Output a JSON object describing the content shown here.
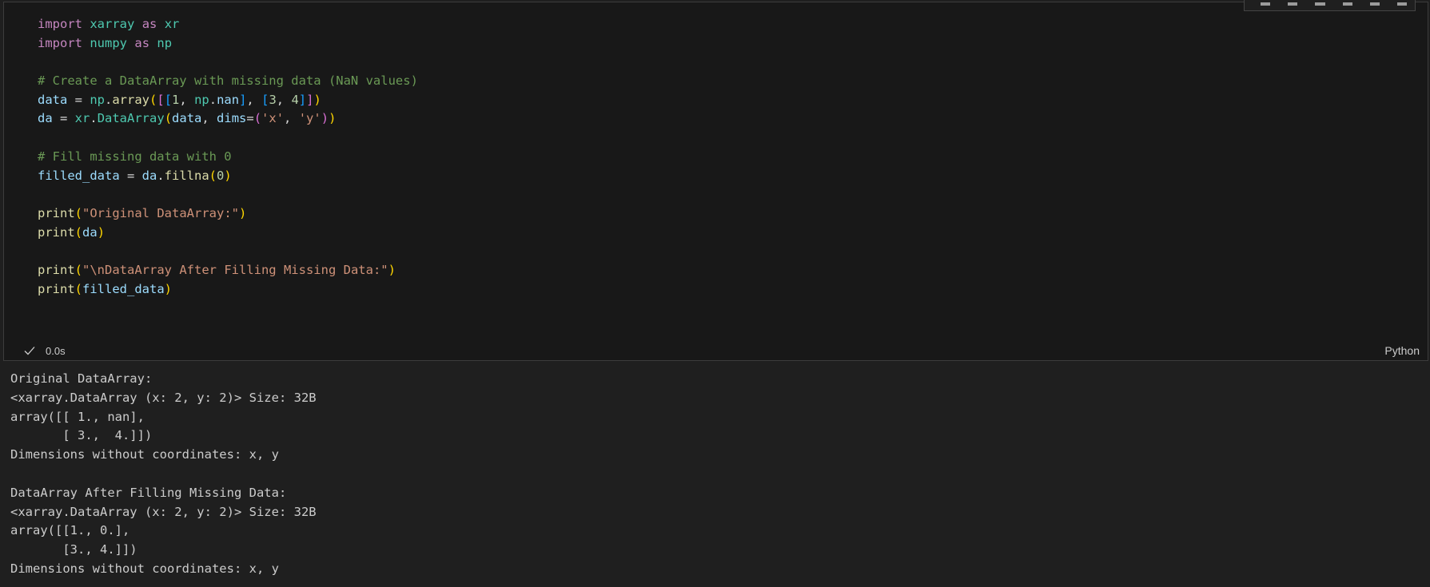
{
  "cell": {
    "language": "Python",
    "status": "0.0s",
    "status_icon": "check-icon",
    "toolbar_icons": [
      "run-by-line-icon",
      "execute-above-icon",
      "execute-below-icon",
      "split-cell-icon",
      "more-icon",
      "delete-icon"
    ],
    "code_lines": [
      [
        {
          "t": "import",
          "c": "kw"
        },
        {
          "t": " ",
          "c": "op"
        },
        {
          "t": "xarray",
          "c": "mod"
        },
        {
          "t": " ",
          "c": "op"
        },
        {
          "t": "as",
          "c": "kw"
        },
        {
          "t": " ",
          "c": "op"
        },
        {
          "t": "xr",
          "c": "mod"
        }
      ],
      [
        {
          "t": "import",
          "c": "kw"
        },
        {
          "t": " ",
          "c": "op"
        },
        {
          "t": "numpy",
          "c": "mod"
        },
        {
          "t": " ",
          "c": "op"
        },
        {
          "t": "as",
          "c": "kw"
        },
        {
          "t": " ",
          "c": "op"
        },
        {
          "t": "np",
          "c": "mod"
        }
      ],
      [],
      [
        {
          "t": "# Create a DataArray with missing data (NaN values)",
          "c": "cmt"
        }
      ],
      [
        {
          "t": "data",
          "c": "var"
        },
        {
          "t": " = ",
          "c": "op"
        },
        {
          "t": "np",
          "c": "mod"
        },
        {
          "t": ".",
          "c": "op"
        },
        {
          "t": "array",
          "c": "fn"
        },
        {
          "t": "(",
          "c": "b1"
        },
        {
          "t": "[",
          "c": "b2"
        },
        {
          "t": "[",
          "c": "b3"
        },
        {
          "t": "1",
          "c": "num"
        },
        {
          "t": ", ",
          "c": "op"
        },
        {
          "t": "np",
          "c": "mod"
        },
        {
          "t": ".",
          "c": "op"
        },
        {
          "t": "nan",
          "c": "var"
        },
        {
          "t": "]",
          "c": "b3"
        },
        {
          "t": ", ",
          "c": "op"
        },
        {
          "t": "[",
          "c": "b3"
        },
        {
          "t": "3",
          "c": "num"
        },
        {
          "t": ", ",
          "c": "op"
        },
        {
          "t": "4",
          "c": "num"
        },
        {
          "t": "]",
          "c": "b3"
        },
        {
          "t": "]",
          "c": "b2"
        },
        {
          "t": ")",
          "c": "b1"
        }
      ],
      [
        {
          "t": "da",
          "c": "var"
        },
        {
          "t": " = ",
          "c": "op"
        },
        {
          "t": "xr",
          "c": "mod"
        },
        {
          "t": ".",
          "c": "op"
        },
        {
          "t": "DataArray",
          "c": "mod"
        },
        {
          "t": "(",
          "c": "b1"
        },
        {
          "t": "data",
          "c": "var"
        },
        {
          "t": ", ",
          "c": "op"
        },
        {
          "t": "dims",
          "c": "var"
        },
        {
          "t": "=",
          "c": "op"
        },
        {
          "t": "(",
          "c": "b2"
        },
        {
          "t": "'x'",
          "c": "str"
        },
        {
          "t": ", ",
          "c": "op"
        },
        {
          "t": "'y'",
          "c": "str"
        },
        {
          "t": ")",
          "c": "b2"
        },
        {
          "t": ")",
          "c": "b1"
        }
      ],
      [],
      [
        {
          "t": "# Fill missing data with 0",
          "c": "cmt"
        }
      ],
      [
        {
          "t": "filled_data",
          "c": "var"
        },
        {
          "t": " = ",
          "c": "op"
        },
        {
          "t": "da",
          "c": "var"
        },
        {
          "t": ".",
          "c": "op"
        },
        {
          "t": "fillna",
          "c": "fn"
        },
        {
          "t": "(",
          "c": "b1"
        },
        {
          "t": "0",
          "c": "num"
        },
        {
          "t": ")",
          "c": "b1"
        }
      ],
      [],
      [
        {
          "t": "print",
          "c": "fn"
        },
        {
          "t": "(",
          "c": "b1"
        },
        {
          "t": "\"Original DataArray:\"",
          "c": "str"
        },
        {
          "t": ")",
          "c": "b1"
        }
      ],
      [
        {
          "t": "print",
          "c": "fn"
        },
        {
          "t": "(",
          "c": "b1"
        },
        {
          "t": "da",
          "c": "var"
        },
        {
          "t": ")",
          "c": "b1"
        }
      ],
      [],
      [
        {
          "t": "print",
          "c": "fn"
        },
        {
          "t": "(",
          "c": "b1"
        },
        {
          "t": "\"\\nDataArray After Filling Missing Data:\"",
          "c": "str"
        },
        {
          "t": ")",
          "c": "b1"
        }
      ],
      [
        {
          "t": "print",
          "c": "fn"
        },
        {
          "t": "(",
          "c": "b1"
        },
        {
          "t": "filled_data",
          "c": "var"
        },
        {
          "t": ")",
          "c": "b1"
        }
      ]
    ]
  },
  "output_lines": [
    "Original DataArray:",
    "<xarray.DataArray (x: 2, y: 2)> Size: 32B",
    "array([[ 1., nan],",
    "       [ 3.,  4.]])",
    "Dimensions without coordinates: x, y",
    "",
    "DataArray After Filling Missing Data:",
    "<xarray.DataArray (x: 2, y: 2)> Size: 32B",
    "array([[1., 0.],",
    "       [3., 4.]])",
    "Dimensions without coordinates: x, y"
  ]
}
